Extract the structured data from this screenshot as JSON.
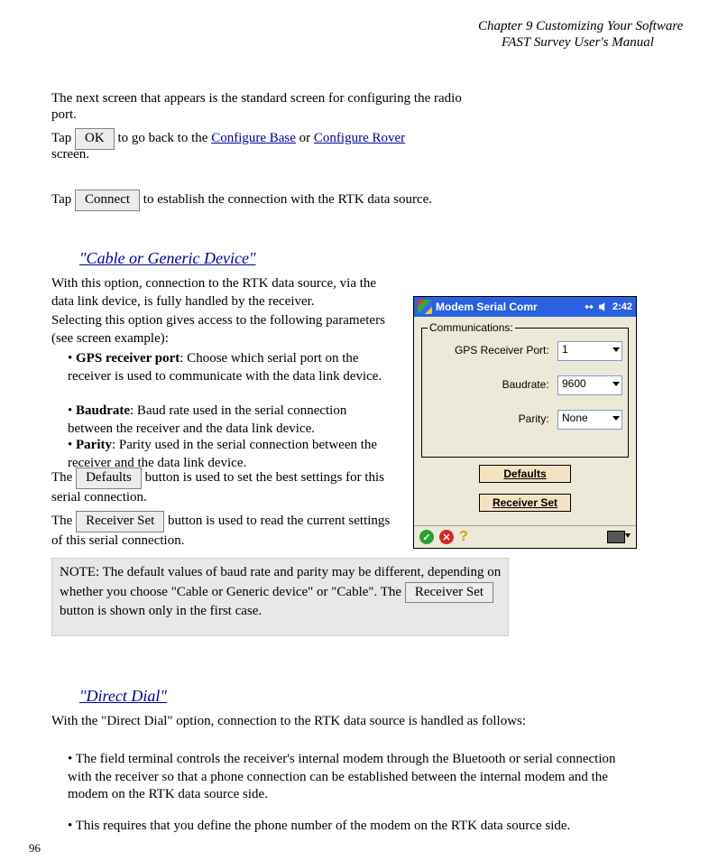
{
  "header": {
    "chapter": "Chapter 9   Customizing Your Software",
    "section": "FAST Survey User's Manual"
  },
  "main": {
    "intro_line": "The next screen that appears is the standard screen for configuring the radio",
    "intro_line2": "port.",
    "tap_ok_line1": "Tap ",
    "tap_ok_btn": "OK",
    "tap_ok_line2": " to go back to the ",
    "link_configure_base": "Configure Base",
    "tap_ok_line3": " or ",
    "link_configure_rover": "Configure Rover",
    "tap_ok_line4": " screen.",
    "tap_connect1": "Tap ",
    "tap_connect_btn": "Connect",
    "tap_connect2": " to establish the connection with the RTK data source."
  },
  "sec": {
    "title": "\"Cable or Generic Device\"",
    "body1": "With this option, connection to the RTK data source, via the data link device, is fully handled by the receiver.",
    "body2": "Selecting this option gives access to the following parameters (see screen example):",
    "bul1": {
      "l": "• ",
      "b": "GPS receiver port",
      "t": ": Choose which serial port on the receiver is used to communicate with the data link device."
    },
    "bul2": {
      "l": "• ",
      "b": "Baudrate",
      "t": ": Baud rate used in the serial connection between the receiver and the data link device."
    },
    "bul3": {
      "l": "• ",
      "b": "Parity",
      "t": ": Parity used in the serial connection between the receiver and the data link device."
    },
    "defaults1": "The ",
    "defaults_btn": "Defaults",
    "defaults2": " button is used to set the best settings for this serial connection.",
    "recvset1": "The ",
    "recvset_btn": "Receiver Set",
    "recvset2": " button is used to read the current settings of this serial connection.",
    "note_l1": "NOTE: The default values of baud rate and parity may be different, depending on whether you choose \"Cable or Generic device\" or \"Cable\". The ",
    "note_btn": "Receiver Set",
    "note_l2": " button is shown only in the first case."
  },
  "sec2": {
    "title": "\"Direct Dial\"",
    "body": "With the \"Direct Dial\" option, connection to the RTK data source is handled as follows:",
    "b1": "• The field terminal controls the receiver's internal modem through the Bluetooth or serial connection with the receiver so that a phone connection can be established between the internal modem and the modem on the RTK data source side.",
    "b2": "• This requires that you define the phone number of the modem on the RTK data source side."
  },
  "mock": {
    "title": "Modem Serial Comr",
    "time": "2:42",
    "group": "Communications:",
    "l1": "GPS Receiver Port:",
    "v1": "1",
    "l2": "Baudrate:",
    "v2": "9600",
    "l3": "Parity:",
    "v3": "None",
    "btn1": "Defaults",
    "btn2": "Receiver Set"
  },
  "footer": "96"
}
